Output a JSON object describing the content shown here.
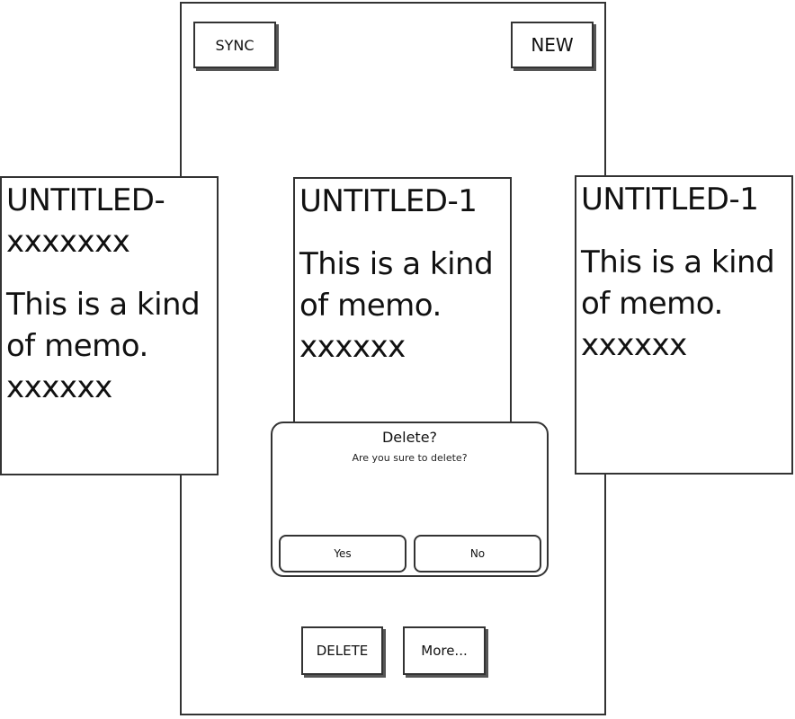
{
  "toolbar": {
    "sync_label": "SYNC",
    "new_label": "NEW"
  },
  "memos": [
    {
      "title": "UNTITLED-\nxxxxxxx",
      "body": "This is a kind\nof memo.\nxxxxxx"
    },
    {
      "title": "UNTITLED-1",
      "body": "This is a kind\nof memo.\nxxxxxx"
    },
    {
      "title": "UNTITLED-1",
      "body": "This is a kind\nof memo.\nxxxxxx"
    }
  ],
  "dialog": {
    "title": "Delete?",
    "message": "Are you sure to delete?",
    "yes_label": "Yes",
    "no_label": "No"
  },
  "actions": {
    "delete_label": "DELETE",
    "more_label": "More..."
  }
}
